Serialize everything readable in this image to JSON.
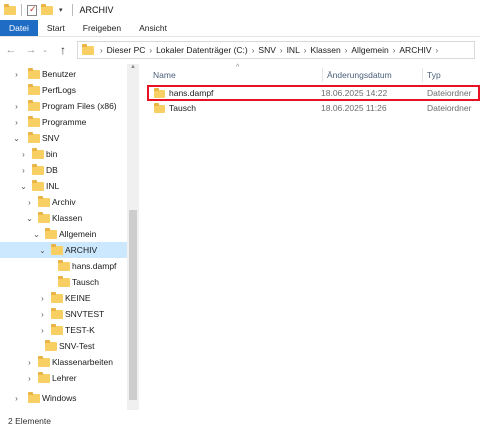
{
  "window": {
    "title": "ARCHIV"
  },
  "ribbon": {
    "tabs": [
      "Datei",
      "Start",
      "Freigeben",
      "Ansicht"
    ]
  },
  "address": {
    "crumbs": [
      "Dieser PC",
      "Lokaler Datenträger (C:)",
      "SNV",
      "INL",
      "Klassen",
      "Allgemein",
      "ARCHIV"
    ]
  },
  "sidebar": {
    "items": [
      {
        "label": "Benutzer",
        "chevron": "›"
      },
      {
        "label": "PerfLogs",
        "chevron": ""
      },
      {
        "label": "Program Files (x86)",
        "chevron": "›"
      },
      {
        "label": "Programme",
        "chevron": "›"
      },
      {
        "label": "SNV",
        "chevron": "⌄"
      },
      {
        "label": "bin",
        "chevron": "›"
      },
      {
        "label": "DB",
        "chevron": "›"
      },
      {
        "label": "INL",
        "chevron": "⌄"
      },
      {
        "label": "Archiv",
        "chevron": "›"
      },
      {
        "label": "Klassen",
        "chevron": "⌄"
      },
      {
        "label": "Allgemein",
        "chevron": "⌄"
      },
      {
        "label": "ARCHIV",
        "chevron": "⌄"
      },
      {
        "label": "hans.dampf",
        "chevron": ""
      },
      {
        "label": "Tausch",
        "chevron": ""
      },
      {
        "label": "KEINE",
        "chevron": "›"
      },
      {
        "label": "SNVTEST",
        "chevron": "›"
      },
      {
        "label": "TEST-K",
        "chevron": "›"
      },
      {
        "label": "SNV-Test",
        "chevron": ""
      },
      {
        "label": "Klassenarbeiten",
        "chevron": "›"
      },
      {
        "label": "Lehrer",
        "chevron": "›"
      },
      {
        "label": "Windows",
        "chevron": "›"
      }
    ]
  },
  "columns": {
    "name": "Name",
    "date": "Änderungsdatum",
    "type": "Typ"
  },
  "files": [
    {
      "name": "hans.dampf",
      "date": "18.06.2025 14:22",
      "type": "Dateiordner"
    },
    {
      "name": "Tausch",
      "date": "18.06.2025 11:26",
      "type": "Dateiordner"
    }
  ],
  "status": {
    "count": "2 Elemente"
  },
  "colors": {
    "accent": "#1f6cc4",
    "selected": "#cce8ff",
    "highlight_box": "#e81123",
    "folder": "#f7cf62"
  }
}
